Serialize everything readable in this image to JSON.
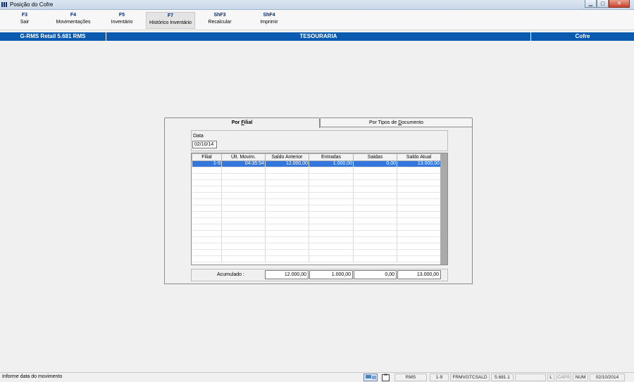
{
  "window": {
    "title": "Posição do Cofre"
  },
  "toolbar": {
    "keys": [
      {
        "key": "F3",
        "label": "Sair"
      },
      {
        "key": "F4",
        "label": "Movimentações"
      },
      {
        "key": "F5",
        "label": "Inventário"
      },
      {
        "key": "F7",
        "label": "Histórico Inventário"
      },
      {
        "key": "ShF3",
        "label": "Recalcular"
      },
      {
        "key": "ShF4",
        "label": "Imprimir"
      }
    ]
  },
  "header": {
    "app": "G-RMS Retail 5.681 RMS",
    "module": "TESOURARIA",
    "section": "Cofre"
  },
  "tabs": {
    "active_pre": "Por ",
    "active_u": "F",
    "active_post": "ilial",
    "inactive_pre": "Por Tipos de ",
    "inactive_u": "D",
    "inactive_post": "ocumento"
  },
  "form": {
    "date_label": "Data",
    "date_value": "02/10/14"
  },
  "grid": {
    "columns": [
      "Filial",
      "Últ. Movim.",
      "Saldo Anterior",
      "Entradas",
      "Saidas",
      "Saldo Atual"
    ],
    "rows": [
      [
        "1-9",
        "04:35:54",
        "12.000,00",
        "1.000,00",
        "0,00",
        "13.000,00"
      ]
    ]
  },
  "footer": {
    "label": "Acumulado :",
    "saldo_anterior": "12.000,00",
    "entradas": "1.000,00",
    "saidas": "0,00",
    "saldo_atual": "13.000,00"
  },
  "status": {
    "message": "Informe data do movimento",
    "rms": "RMS",
    "filial": "1-9",
    "form": "FRMVGTCSALD",
    "version": "5.681.1",
    "l": "L",
    "caps": "CAPS",
    "num": "NUM",
    "date": "02/10/2014"
  },
  "colors": {
    "header_bg": "#0a5bb0",
    "selected_row": "#3377dd",
    "key_color": "#002a7c"
  }
}
